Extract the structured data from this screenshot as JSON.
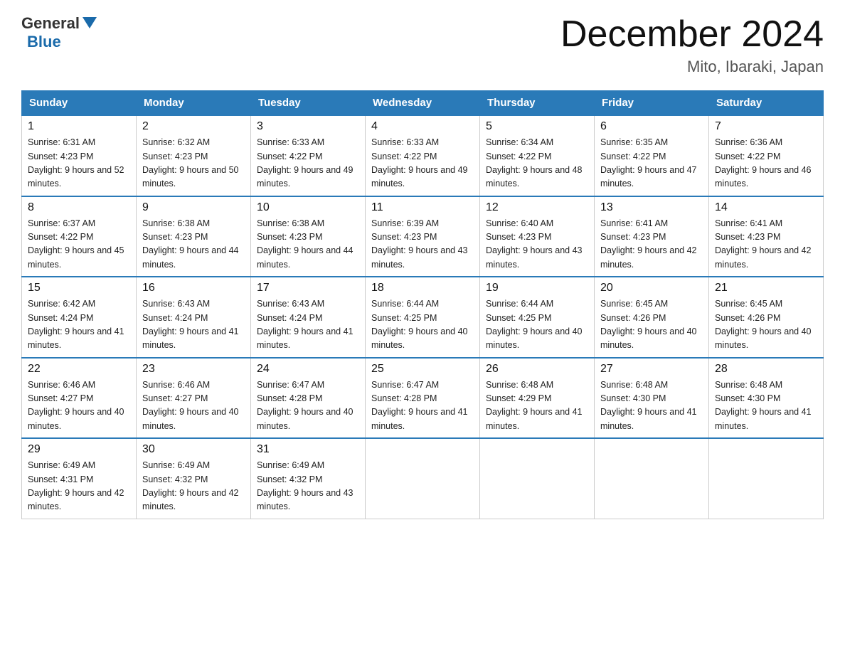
{
  "header": {
    "logo_general": "General",
    "logo_blue": "Blue",
    "month_year": "December 2024",
    "location": "Mito, Ibaraki, Japan"
  },
  "days_of_week": [
    "Sunday",
    "Monday",
    "Tuesday",
    "Wednesday",
    "Thursday",
    "Friday",
    "Saturday"
  ],
  "weeks": [
    [
      {
        "day": "1",
        "sunrise": "6:31 AM",
        "sunset": "4:23 PM",
        "daylight": "9 hours and 52 minutes."
      },
      {
        "day": "2",
        "sunrise": "6:32 AM",
        "sunset": "4:23 PM",
        "daylight": "9 hours and 50 minutes."
      },
      {
        "day": "3",
        "sunrise": "6:33 AM",
        "sunset": "4:22 PM",
        "daylight": "9 hours and 49 minutes."
      },
      {
        "day": "4",
        "sunrise": "6:33 AM",
        "sunset": "4:22 PM",
        "daylight": "9 hours and 49 minutes."
      },
      {
        "day": "5",
        "sunrise": "6:34 AM",
        "sunset": "4:22 PM",
        "daylight": "9 hours and 48 minutes."
      },
      {
        "day": "6",
        "sunrise": "6:35 AM",
        "sunset": "4:22 PM",
        "daylight": "9 hours and 47 minutes."
      },
      {
        "day": "7",
        "sunrise": "6:36 AM",
        "sunset": "4:22 PM",
        "daylight": "9 hours and 46 minutes."
      }
    ],
    [
      {
        "day": "8",
        "sunrise": "6:37 AM",
        "sunset": "4:22 PM",
        "daylight": "9 hours and 45 minutes."
      },
      {
        "day": "9",
        "sunrise": "6:38 AM",
        "sunset": "4:23 PM",
        "daylight": "9 hours and 44 minutes."
      },
      {
        "day": "10",
        "sunrise": "6:38 AM",
        "sunset": "4:23 PM",
        "daylight": "9 hours and 44 minutes."
      },
      {
        "day": "11",
        "sunrise": "6:39 AM",
        "sunset": "4:23 PM",
        "daylight": "9 hours and 43 minutes."
      },
      {
        "day": "12",
        "sunrise": "6:40 AM",
        "sunset": "4:23 PM",
        "daylight": "9 hours and 43 minutes."
      },
      {
        "day": "13",
        "sunrise": "6:41 AM",
        "sunset": "4:23 PM",
        "daylight": "9 hours and 42 minutes."
      },
      {
        "day": "14",
        "sunrise": "6:41 AM",
        "sunset": "4:23 PM",
        "daylight": "9 hours and 42 minutes."
      }
    ],
    [
      {
        "day": "15",
        "sunrise": "6:42 AM",
        "sunset": "4:24 PM",
        "daylight": "9 hours and 41 minutes."
      },
      {
        "day": "16",
        "sunrise": "6:43 AM",
        "sunset": "4:24 PM",
        "daylight": "9 hours and 41 minutes."
      },
      {
        "day": "17",
        "sunrise": "6:43 AM",
        "sunset": "4:24 PM",
        "daylight": "9 hours and 41 minutes."
      },
      {
        "day": "18",
        "sunrise": "6:44 AM",
        "sunset": "4:25 PM",
        "daylight": "9 hours and 40 minutes."
      },
      {
        "day": "19",
        "sunrise": "6:44 AM",
        "sunset": "4:25 PM",
        "daylight": "9 hours and 40 minutes."
      },
      {
        "day": "20",
        "sunrise": "6:45 AM",
        "sunset": "4:26 PM",
        "daylight": "9 hours and 40 minutes."
      },
      {
        "day": "21",
        "sunrise": "6:45 AM",
        "sunset": "4:26 PM",
        "daylight": "9 hours and 40 minutes."
      }
    ],
    [
      {
        "day": "22",
        "sunrise": "6:46 AM",
        "sunset": "4:27 PM",
        "daylight": "9 hours and 40 minutes."
      },
      {
        "day": "23",
        "sunrise": "6:46 AM",
        "sunset": "4:27 PM",
        "daylight": "9 hours and 40 minutes."
      },
      {
        "day": "24",
        "sunrise": "6:47 AM",
        "sunset": "4:28 PM",
        "daylight": "9 hours and 40 minutes."
      },
      {
        "day": "25",
        "sunrise": "6:47 AM",
        "sunset": "4:28 PM",
        "daylight": "9 hours and 41 minutes."
      },
      {
        "day": "26",
        "sunrise": "6:48 AM",
        "sunset": "4:29 PM",
        "daylight": "9 hours and 41 minutes."
      },
      {
        "day": "27",
        "sunrise": "6:48 AM",
        "sunset": "4:30 PM",
        "daylight": "9 hours and 41 minutes."
      },
      {
        "day": "28",
        "sunrise": "6:48 AM",
        "sunset": "4:30 PM",
        "daylight": "9 hours and 41 minutes."
      }
    ],
    [
      {
        "day": "29",
        "sunrise": "6:49 AM",
        "sunset": "4:31 PM",
        "daylight": "9 hours and 42 minutes."
      },
      {
        "day": "30",
        "sunrise": "6:49 AM",
        "sunset": "4:32 PM",
        "daylight": "9 hours and 42 minutes."
      },
      {
        "day": "31",
        "sunrise": "6:49 AM",
        "sunset": "4:32 PM",
        "daylight": "9 hours and 43 minutes."
      },
      null,
      null,
      null,
      null
    ]
  ]
}
